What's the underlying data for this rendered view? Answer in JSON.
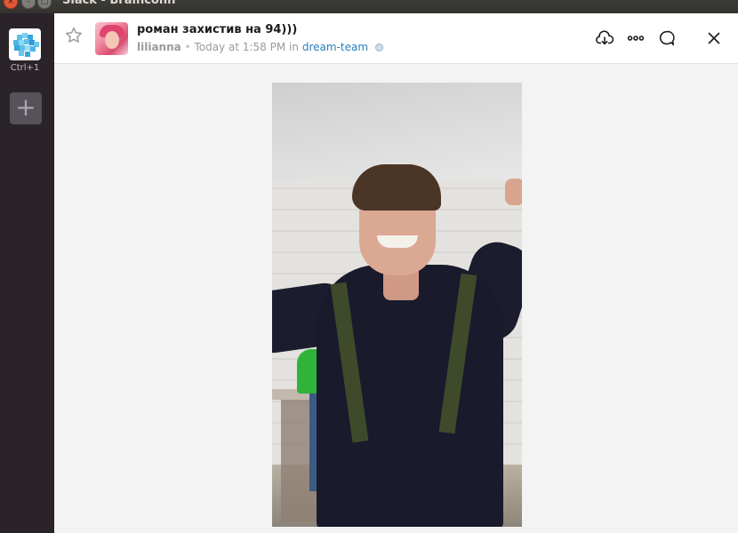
{
  "window": {
    "title": "Slack - Brainconn",
    "controls": [
      "close",
      "minimize",
      "maximize"
    ]
  },
  "sidebar": {
    "team_shortcut": "Ctrl+1",
    "add_team_icon": "+"
  },
  "file_header": {
    "title": "роман захистив на 94)))",
    "user": "lilianna",
    "separator": "•",
    "timestamp": "Today at 1:58 PM",
    "in_label": "in",
    "channel": "dream-team",
    "icons": [
      "star-icon",
      "download-icon",
      "more-icon",
      "comment-icon",
      "close-icon"
    ]
  },
  "colors": {
    "titlebar": "#3a3935",
    "sidebar": "#2a2329",
    "close_button": "#e2593a",
    "channel_link": "#2a80b9",
    "content_bg": "#f3f3f3"
  }
}
